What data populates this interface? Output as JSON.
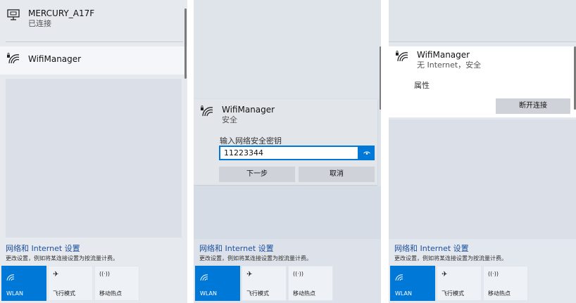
{
  "panel1": {
    "connected_network": {
      "name": "MERCURY_A17F",
      "status": "已连接"
    },
    "selected_network": {
      "name": "WifiManager"
    }
  },
  "panel2": {
    "network": {
      "name": "WifiManager",
      "status": "安全"
    },
    "password_label": "输入网络安全密钥",
    "password_value": "11223344",
    "next_button": "下一步",
    "cancel_button": "取消"
  },
  "panel3": {
    "network": {
      "name": "WifiManager",
      "status": "无 Internet，安全"
    },
    "properties_link": "属性",
    "disconnect_button": "断开连接"
  },
  "settings": {
    "title": "网络和 Internet 设置",
    "description": "更改设置，例如将某连接设置为按流量计费。"
  },
  "tiles": [
    {
      "label": "WLAN",
      "icon": "wifi-icon",
      "active": true
    },
    {
      "label": "飞行模式",
      "icon": "airplane-icon",
      "active": false
    },
    {
      "label": "移动热点",
      "icon": "hotspot-icon",
      "active": false
    }
  ],
  "colors": {
    "accent": "#0078d7",
    "link": "#1b4f9c"
  }
}
